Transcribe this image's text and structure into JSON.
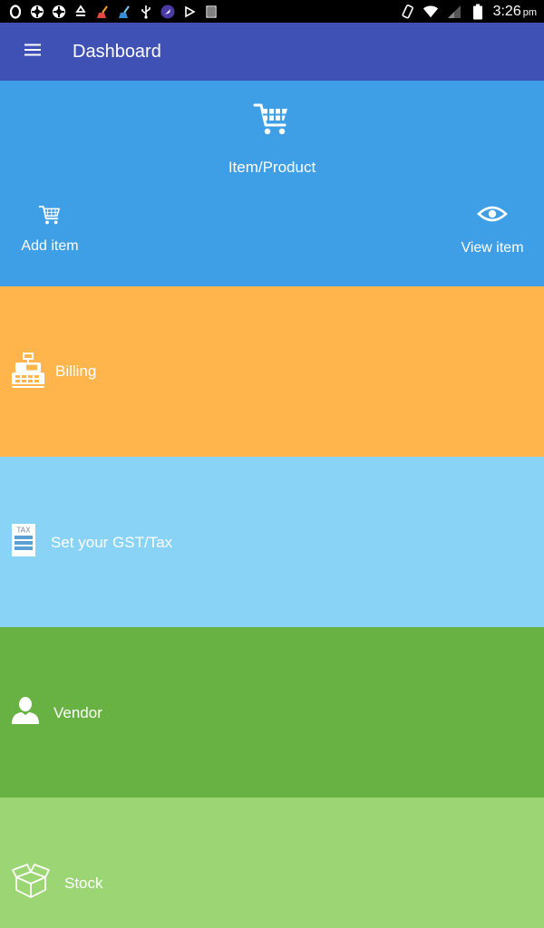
{
  "status_bar": {
    "time": "3:26",
    "ampm": "pm",
    "left_icons": [
      "opera-icon",
      "app-icon",
      "app-icon",
      "recycle-icon",
      "broom-icon",
      "broom-icon",
      "usb-icon",
      "rocket-icon",
      "play-icon",
      "barcode-icon"
    ],
    "right_icons": [
      "rotate-icon",
      "wifi-icon",
      "signal-icon",
      "battery-icon"
    ]
  },
  "app_bar": {
    "title": "Dashboard",
    "menu_icon": "hamburger-menu-icon",
    "color": "#3F51B5"
  },
  "sections": {
    "item_product": {
      "label": "Item/Product",
      "color": "#3E9FE6",
      "icon": "cart-icon",
      "add_item": {
        "label": "Add item",
        "icon": "cart-icon"
      },
      "view_item": {
        "label": "View item",
        "icon": "eye-icon"
      }
    },
    "billing": {
      "label": "Billing",
      "color": "#FFB54B",
      "icon": "cash-register-icon"
    },
    "gst": {
      "label": "Set your GST/Tax",
      "color": "#89D3F7",
      "icon": "tax-document-icon",
      "icon_text": "TAX"
    },
    "vendor": {
      "label": "Vendor",
      "color": "#68B143",
      "icon": "person-icon"
    },
    "stock": {
      "label": "Stock",
      "color": "#9CD573",
      "icon": "box-icon"
    }
  }
}
